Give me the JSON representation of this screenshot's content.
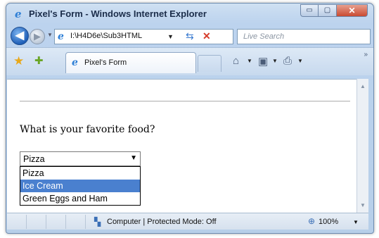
{
  "window": {
    "title": "Pixel's Form - Windows Internet Explorer",
    "min_glyph": "▭",
    "max_glyph": "▢",
    "close_glyph": "✕"
  },
  "navbar": {
    "back_glyph": "◀",
    "forward_glyph": "▶",
    "address": "I:\\H4D6e\\Sub3HTML",
    "search_placeholder": "Live Search"
  },
  "tab": {
    "label": "Pixel's Form"
  },
  "content": {
    "question": "What is your favorite food?",
    "select_value": "Pizza",
    "options": [
      "Pizza",
      "Ice Cream",
      "Green Eggs and Ham"
    ],
    "highlighted_option": "Ice Cream"
  },
  "status": {
    "zone": "Computer | Protected Mode: Off",
    "zoom": "100%"
  },
  "colors": {
    "highlight": "#4a80cf",
    "chrome": "#bcd3ee"
  }
}
